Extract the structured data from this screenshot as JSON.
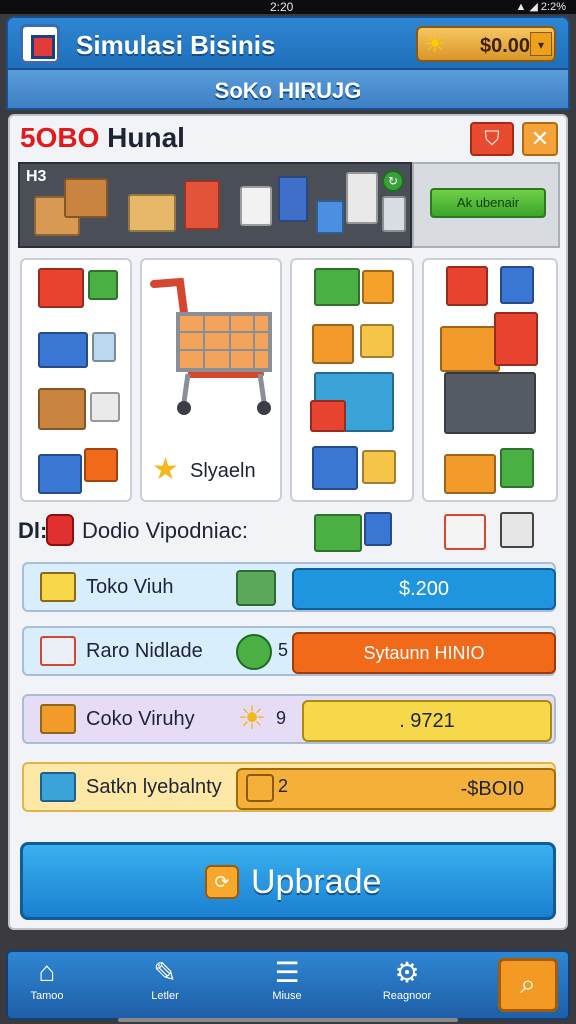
{
  "status": {
    "time": "2:20",
    "battery": "2:2%"
  },
  "header": {
    "title": "Simulasi Bisinis",
    "coins": "$0.00",
    "subtitle": "SoKo HIRUJG"
  },
  "store": {
    "name_red": "5OBO",
    "name_dark": "Hunal"
  },
  "shelf": {
    "heading": "H3",
    "button_label": "Ak ubenair"
  },
  "featured_item": {
    "label": "Slyaeln"
  },
  "section": {
    "prefix": "Dl:",
    "title": "Dodio Vipodniac:"
  },
  "rows": [
    {
      "label": "Toko Viuh",
      "value": "$.200",
      "value_color": "#1f95e0"
    },
    {
      "label": "Raro Nidlade",
      "mid": "5",
      "value": "Sytaunn HINIO",
      "value_color": "#f06a1a"
    },
    {
      "label": "Coko Viruhy",
      "mid": "9",
      "value": ". 9721",
      "value_color": "#f7d84a"
    },
    {
      "label": "Satkn lyebalnty",
      "mid": "2",
      "value": "-$BOI0",
      "value_color": "#f5b03a"
    }
  ],
  "upgrade": {
    "label": "Upbrade"
  },
  "nav": [
    {
      "label": "Tamoo",
      "icon": "home-icon"
    },
    {
      "label": "Letler",
      "icon": "edit-icon"
    },
    {
      "label": "Miuse",
      "icon": "list-icon"
    },
    {
      "label": "Reagnoor",
      "icon": "gear-icon"
    },
    {
      "label": "",
      "icon": "search-icon"
    }
  ],
  "colors": {
    "accent": "#2e86d2",
    "danger": "#e11b1b",
    "orange": "#f39a24"
  }
}
